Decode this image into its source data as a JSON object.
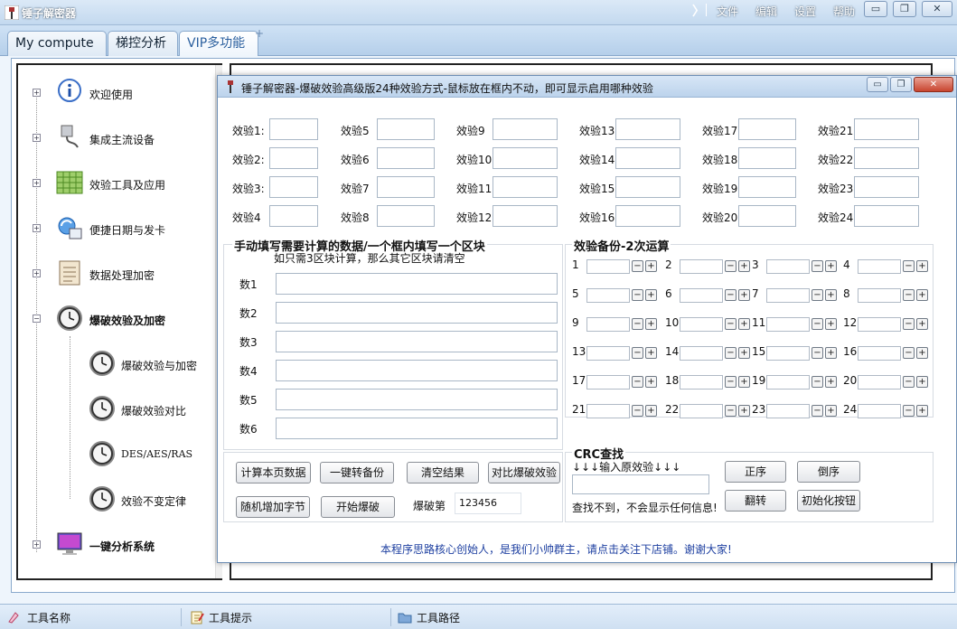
{
  "app": {
    "title": "锤子解密器"
  },
  "menu": {
    "items": [
      "文件",
      "编辑",
      "设置",
      "帮助"
    ]
  },
  "window_controls": {
    "minimize": "▭",
    "restore": "❐",
    "close": "✕"
  },
  "tabs": [
    {
      "label": "My compute"
    },
    {
      "label": "梯控分析"
    },
    {
      "label": "VIP多功能"
    }
  ],
  "tree": {
    "items": [
      {
        "label": "欢迎使用",
        "icon": "info-icon"
      },
      {
        "label": "集成主流设备",
        "icon": "usb-device-icon"
      },
      {
        "label": "效验工具及应用",
        "icon": "spreadsheet-icon"
      },
      {
        "label": "便捷日期与发卡",
        "icon": "sync-icon"
      },
      {
        "label": "数据处理加密",
        "icon": "ledger-icon"
      },
      {
        "label": "爆破效验及加密",
        "icon": "clock-icon"
      },
      {
        "label": "爆破效验与加密",
        "icon": "clock-icon"
      },
      {
        "label": "爆破效验对比",
        "icon": "clock-icon"
      },
      {
        "label": "DES/AES/RAS",
        "icon": "clock-icon"
      },
      {
        "label": "效验不变定律",
        "icon": "clock-icon"
      },
      {
        "label": "一键分析系统",
        "icon": "monitor-icon"
      }
    ]
  },
  "dialog": {
    "title": "锤子解密器-爆破效验高级版24种效验方式-鼠标放在框内不动，即可显示启用哪种效验",
    "checks": [
      "效验1:",
      "效验2:",
      "效验3:",
      "效验4",
      "效验5",
      "效验6",
      "效验7",
      "效验8",
      "效验9",
      "效验10",
      "效验11",
      "效验12",
      "效验13",
      "效验14",
      "效验15",
      "效验16",
      "效验17",
      "效验18",
      "效验19",
      "效验20",
      "效验21",
      "效验22",
      "效验23",
      "效验24"
    ],
    "manual": {
      "title": "手动填写需要计算的数据/一个框内填写一个区块",
      "subtitle": "如只需3区块计算，那么其它区块请清空",
      "fields": [
        "数1",
        "数2",
        "数3",
        "数4",
        "数5",
        "数6"
      ]
    },
    "backup": {
      "title": "效验备份-2次运算",
      "numbers": [
        "1",
        "2",
        "3",
        "4",
        "5",
        "6",
        "7",
        "8",
        "9",
        "10",
        "11",
        "12",
        "13",
        "14",
        "15",
        "16",
        "17",
        "18",
        "19",
        "20",
        "21",
        "22",
        "23",
        "24"
      ],
      "minus": "−",
      "plus": "+"
    },
    "buttons": {
      "calc": "计算本页数据",
      "to_backup": "一键转备份",
      "clear": "清空结果",
      "compare": "对比爆破效验",
      "random": "随机增加字节",
      "start": "开始爆破",
      "count_label": "爆破第",
      "count_value": "123456"
    },
    "crc": {
      "title": "CRC查找",
      "hint": "↓↓↓输入原效验↓↓↓",
      "not_found": "查找不到，不会显示任何信息!",
      "forward": "正序",
      "reverse": "倒序",
      "flip": "翻转",
      "init": "初始化按钮"
    },
    "footer": "本程序思路核心创始人，是我们小帅群主，请点击关注下店铺。谢谢大家!"
  },
  "status": {
    "name": "工具名称",
    "hint": "工具提示",
    "path": "工具路径"
  }
}
